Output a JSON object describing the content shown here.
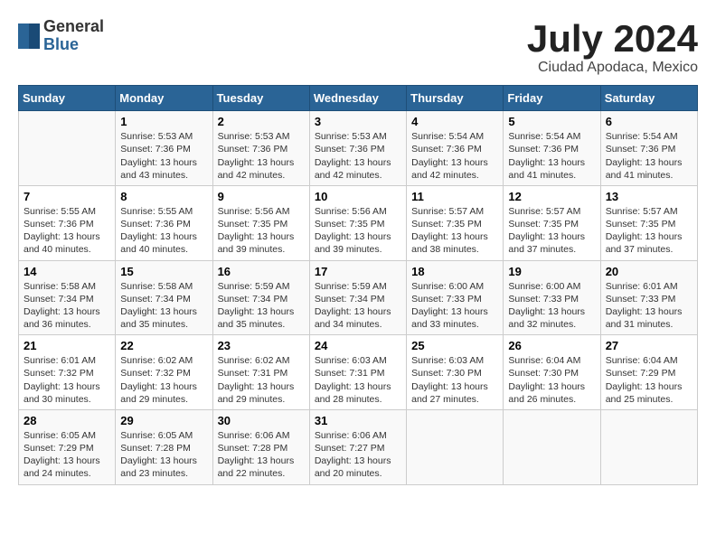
{
  "logo": {
    "general": "General",
    "blue": "Blue"
  },
  "title": "July 2024",
  "subtitle": "Ciudad Apodaca, Mexico",
  "days_of_week": [
    "Sunday",
    "Monday",
    "Tuesday",
    "Wednesday",
    "Thursday",
    "Friday",
    "Saturday"
  ],
  "weeks": [
    [
      {
        "day": "",
        "info": ""
      },
      {
        "day": "1",
        "info": "Sunrise: 5:53 AM\nSunset: 7:36 PM\nDaylight: 13 hours\nand 43 minutes."
      },
      {
        "day": "2",
        "info": "Sunrise: 5:53 AM\nSunset: 7:36 PM\nDaylight: 13 hours\nand 42 minutes."
      },
      {
        "day": "3",
        "info": "Sunrise: 5:53 AM\nSunset: 7:36 PM\nDaylight: 13 hours\nand 42 minutes."
      },
      {
        "day": "4",
        "info": "Sunrise: 5:54 AM\nSunset: 7:36 PM\nDaylight: 13 hours\nand 42 minutes."
      },
      {
        "day": "5",
        "info": "Sunrise: 5:54 AM\nSunset: 7:36 PM\nDaylight: 13 hours\nand 41 minutes."
      },
      {
        "day": "6",
        "info": "Sunrise: 5:54 AM\nSunset: 7:36 PM\nDaylight: 13 hours\nand 41 minutes."
      }
    ],
    [
      {
        "day": "7",
        "info": "Sunrise: 5:55 AM\nSunset: 7:36 PM\nDaylight: 13 hours\nand 40 minutes."
      },
      {
        "day": "8",
        "info": "Sunrise: 5:55 AM\nSunset: 7:36 PM\nDaylight: 13 hours\nand 40 minutes."
      },
      {
        "day": "9",
        "info": "Sunrise: 5:56 AM\nSunset: 7:35 PM\nDaylight: 13 hours\nand 39 minutes."
      },
      {
        "day": "10",
        "info": "Sunrise: 5:56 AM\nSunset: 7:35 PM\nDaylight: 13 hours\nand 39 minutes."
      },
      {
        "day": "11",
        "info": "Sunrise: 5:57 AM\nSunset: 7:35 PM\nDaylight: 13 hours\nand 38 minutes."
      },
      {
        "day": "12",
        "info": "Sunrise: 5:57 AM\nSunset: 7:35 PM\nDaylight: 13 hours\nand 37 minutes."
      },
      {
        "day": "13",
        "info": "Sunrise: 5:57 AM\nSunset: 7:35 PM\nDaylight: 13 hours\nand 37 minutes."
      }
    ],
    [
      {
        "day": "14",
        "info": "Sunrise: 5:58 AM\nSunset: 7:34 PM\nDaylight: 13 hours\nand 36 minutes."
      },
      {
        "day": "15",
        "info": "Sunrise: 5:58 AM\nSunset: 7:34 PM\nDaylight: 13 hours\nand 35 minutes."
      },
      {
        "day": "16",
        "info": "Sunrise: 5:59 AM\nSunset: 7:34 PM\nDaylight: 13 hours\nand 35 minutes."
      },
      {
        "day": "17",
        "info": "Sunrise: 5:59 AM\nSunset: 7:34 PM\nDaylight: 13 hours\nand 34 minutes."
      },
      {
        "day": "18",
        "info": "Sunrise: 6:00 AM\nSunset: 7:33 PM\nDaylight: 13 hours\nand 33 minutes."
      },
      {
        "day": "19",
        "info": "Sunrise: 6:00 AM\nSunset: 7:33 PM\nDaylight: 13 hours\nand 32 minutes."
      },
      {
        "day": "20",
        "info": "Sunrise: 6:01 AM\nSunset: 7:33 PM\nDaylight: 13 hours\nand 31 minutes."
      }
    ],
    [
      {
        "day": "21",
        "info": "Sunrise: 6:01 AM\nSunset: 7:32 PM\nDaylight: 13 hours\nand 30 minutes."
      },
      {
        "day": "22",
        "info": "Sunrise: 6:02 AM\nSunset: 7:32 PM\nDaylight: 13 hours\nand 29 minutes."
      },
      {
        "day": "23",
        "info": "Sunrise: 6:02 AM\nSunset: 7:31 PM\nDaylight: 13 hours\nand 29 minutes."
      },
      {
        "day": "24",
        "info": "Sunrise: 6:03 AM\nSunset: 7:31 PM\nDaylight: 13 hours\nand 28 minutes."
      },
      {
        "day": "25",
        "info": "Sunrise: 6:03 AM\nSunset: 7:30 PM\nDaylight: 13 hours\nand 27 minutes."
      },
      {
        "day": "26",
        "info": "Sunrise: 6:04 AM\nSunset: 7:30 PM\nDaylight: 13 hours\nand 26 minutes."
      },
      {
        "day": "27",
        "info": "Sunrise: 6:04 AM\nSunset: 7:29 PM\nDaylight: 13 hours\nand 25 minutes."
      }
    ],
    [
      {
        "day": "28",
        "info": "Sunrise: 6:05 AM\nSunset: 7:29 PM\nDaylight: 13 hours\nand 24 minutes."
      },
      {
        "day": "29",
        "info": "Sunrise: 6:05 AM\nSunset: 7:28 PM\nDaylight: 13 hours\nand 23 minutes."
      },
      {
        "day": "30",
        "info": "Sunrise: 6:06 AM\nSunset: 7:28 PM\nDaylight: 13 hours\nand 22 minutes."
      },
      {
        "day": "31",
        "info": "Sunrise: 6:06 AM\nSunset: 7:27 PM\nDaylight: 13 hours\nand 20 minutes."
      },
      {
        "day": "",
        "info": ""
      },
      {
        "day": "",
        "info": ""
      },
      {
        "day": "",
        "info": ""
      }
    ]
  ]
}
